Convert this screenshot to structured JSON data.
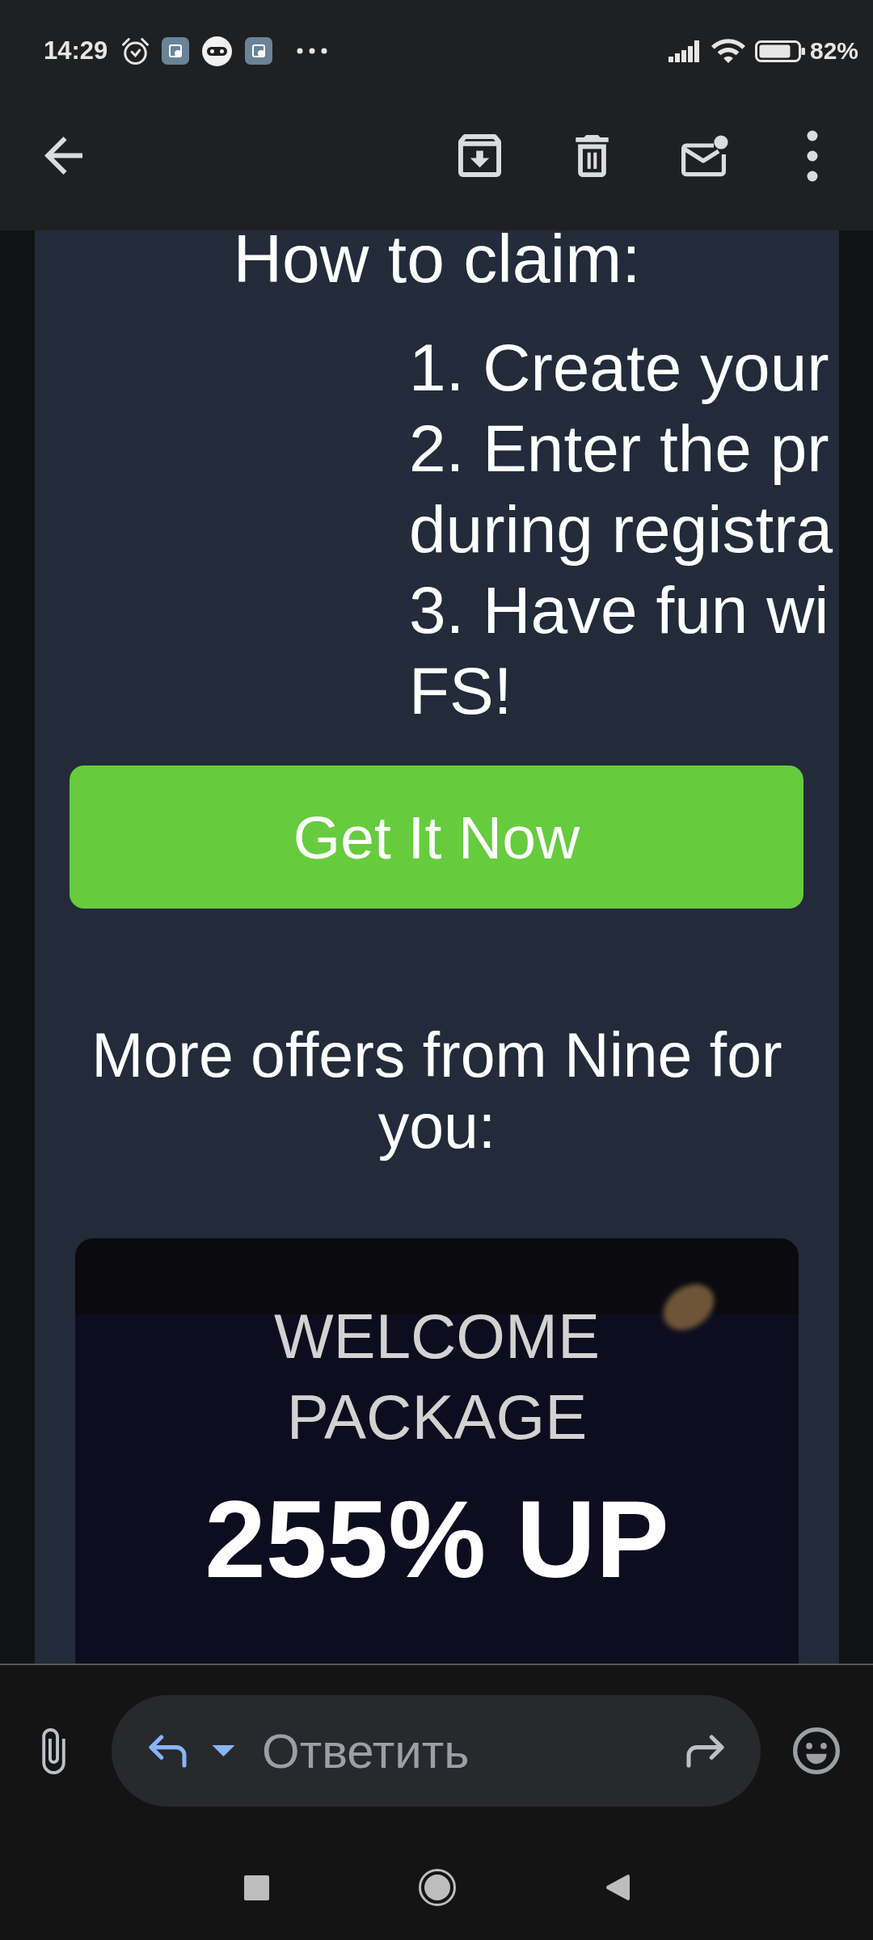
{
  "status_bar": {
    "time": "14:29",
    "battery": "82%"
  },
  "email": {
    "heading": "How to claim:",
    "steps": [
      {
        "lines": [
          "1. Create your"
        ]
      },
      {
        "lines": [
          "2. Enter the pr",
          "during registra"
        ]
      },
      {
        "lines": [
          "3. Have fun wi",
          "FS!"
        ]
      }
    ],
    "button": "Get It Now",
    "more_offers": "More offers from Nine for you:",
    "promo_card": {
      "title": "WELCOME PACKAGE",
      "headline": "255% UP"
    }
  },
  "reply_bar": {
    "placeholder": "Ответить"
  }
}
